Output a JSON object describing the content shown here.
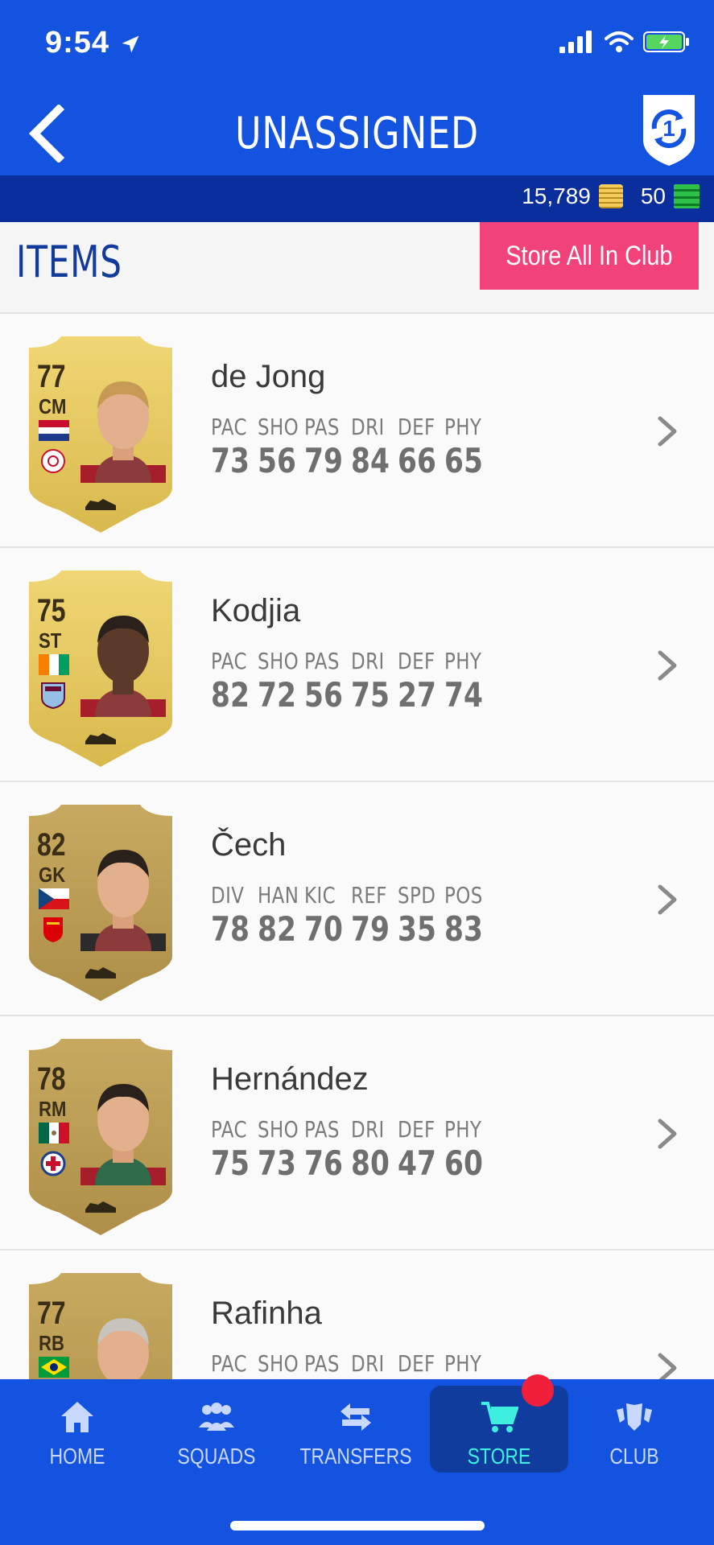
{
  "status": {
    "time": "9:54",
    "icons": [
      "location-arrow-icon",
      "signal-icon",
      "wifi-icon",
      "battery-charging-icon"
    ]
  },
  "header": {
    "title": "UNASSIGNED",
    "back_icon": "chevron-left-icon",
    "action_icon": "shield-refresh-icon",
    "action_badge": "1"
  },
  "currency": {
    "coins": "15,789",
    "points": "50"
  },
  "items": {
    "title": "ITEMS",
    "store_all_label": "Store All In Club"
  },
  "players": [
    {
      "rating": "77",
      "position": "CM",
      "name": "de Jong",
      "stat_labels": [
        "PAC",
        "SHO",
        "PAS",
        "DRI",
        "DEF",
        "PHY"
      ],
      "stat_values": [
        "73",
        "56",
        "79",
        "84",
        "66",
        "65"
      ],
      "card_color": "#f0d675",
      "flag": "netherlands-flag",
      "club": "ajax-crest"
    },
    {
      "rating": "75",
      "position": "ST",
      "name": "Kodjia",
      "stat_labels": [
        "PAC",
        "SHO",
        "PAS",
        "DRI",
        "DEF",
        "PHY"
      ],
      "stat_values": [
        "82",
        "72",
        "56",
        "75",
        "27",
        "74"
      ],
      "card_color": "#f0d675",
      "flag": "ivory-coast-flag",
      "club": "aston-villa-crest"
    },
    {
      "rating": "82",
      "position": "GK",
      "name": "Čech",
      "stat_labels": [
        "DIV",
        "HAN",
        "KIC",
        "REF",
        "SPD",
        "POS"
      ],
      "stat_values": [
        "78",
        "82",
        "70",
        "79",
        "35",
        "83"
      ],
      "card_color": "#c8a960",
      "flag": "czech-flag",
      "club": "arsenal-crest"
    },
    {
      "rating": "78",
      "position": "RM",
      "name": "Hernández",
      "stat_labels": [
        "PAC",
        "SHO",
        "PAS",
        "DRI",
        "DEF",
        "PHY"
      ],
      "stat_values": [
        "75",
        "73",
        "76",
        "80",
        "47",
        "60"
      ],
      "card_color": "#c8a960",
      "flag": "mexico-flag",
      "club": "cruz-azul-crest"
    },
    {
      "rating": "77",
      "position": "RB",
      "name": "Rafinha",
      "stat_labels": [
        "PAC",
        "SHO",
        "PAS",
        "DRI",
        "DEF",
        "PHY"
      ],
      "stat_values": [
        "",
        "",
        "",
        "",
        "",
        ""
      ],
      "card_color": "#c8a960",
      "flag": "brazil-flag",
      "club": ""
    }
  ],
  "tabs": [
    {
      "label": "HOME",
      "icon": "home-icon"
    },
    {
      "label": "SQUADS",
      "icon": "squads-icon"
    },
    {
      "label": "TRANSFERS",
      "icon": "transfers-icon"
    },
    {
      "label": "STORE",
      "icon": "cart-icon",
      "active": true
    },
    {
      "label": "CLUB",
      "icon": "club-icon"
    }
  ],
  "colors": {
    "primary": "#1452e0",
    "dark_bar": "#0a2e9b",
    "pink": "#f2427a",
    "active_tab": "#3ff0e0",
    "badge": "#f0203a"
  }
}
